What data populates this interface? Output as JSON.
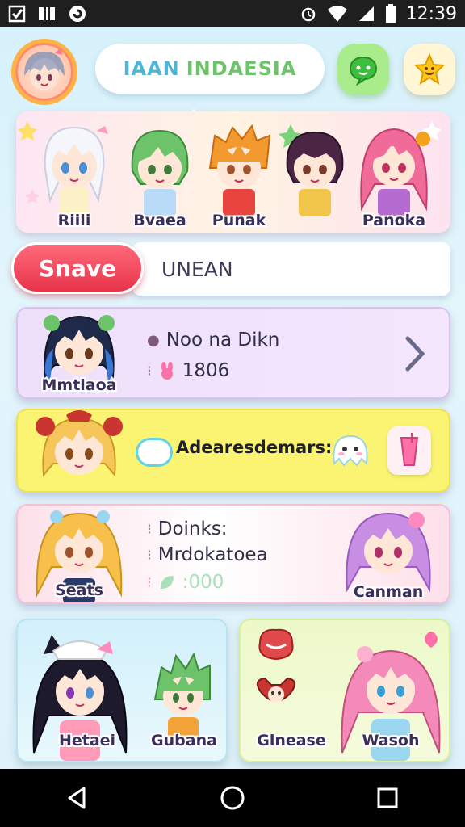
{
  "status_bar": {
    "time": "12:39",
    "left_icons": [
      "checkbox-icon",
      "news-icon",
      "sync-icon"
    ],
    "right_icons": [
      "alarm-icon",
      "wifi-icon",
      "signal-icon",
      "battery-icon"
    ]
  },
  "header": {
    "title_part1": "IAAN",
    "title_part2": "INDAESIA",
    "colors": {
      "title_blue": "#4fb4d8",
      "title_green": "#6cc36a"
    }
  },
  "banner": {
    "characters": [
      {
        "name": "Riili",
        "hair": "#f4f6fb",
        "eye": "#4b8fd6",
        "outfit": "#fdf1c8"
      },
      {
        "name": "Bvaea",
        "hair": "#6cc36a",
        "eye": "#3e7a3a",
        "outfit": "#b9dbf7"
      },
      {
        "name": "Punak",
        "hair": "#f29a2e",
        "eye": "#a0522d",
        "outfit": "#e9453f"
      },
      {
        "name": "",
        "hair": "#4a2544",
        "eye": "#7a3a2a",
        "outfit": "#f2c64a"
      },
      {
        "name": "Panoka",
        "hair": "#f06b9a",
        "eye": "#c0305a",
        "outfit": "#b66bd0"
      }
    ]
  },
  "search": {
    "button_label": "Snave",
    "field_value": "UNEAN"
  },
  "cards": [
    {
      "portrait_name": "Mmtlaoa",
      "line1": "Noo na Dikn",
      "line2": "1806",
      "hair": "#1f2a4a",
      "accent": "#6cc36a"
    },
    {
      "ad_text": "Adearesdemars:",
      "hair": "#f7c65a",
      "accent": "#c9362f"
    },
    {
      "portrait_name": "Seats",
      "right_name": "Canman",
      "line1": "Doinks:",
      "line2": "Mrdokatoea",
      "line3": ":000",
      "hair": "#f6c04a",
      "right_hair": "#c78ee3"
    }
  ],
  "tiles": {
    "left": [
      {
        "name": "Hetaei",
        "hair": "#1e1a2e"
      },
      {
        "name": "Gubana",
        "hair": "#6cc36a"
      }
    ],
    "right": [
      {
        "name": "Glnease"
      },
      {
        "name": "Wasoh",
        "hair": "#f48ab9"
      }
    ]
  },
  "nav": [
    "back-icon",
    "home-icon",
    "recents-icon"
  ]
}
